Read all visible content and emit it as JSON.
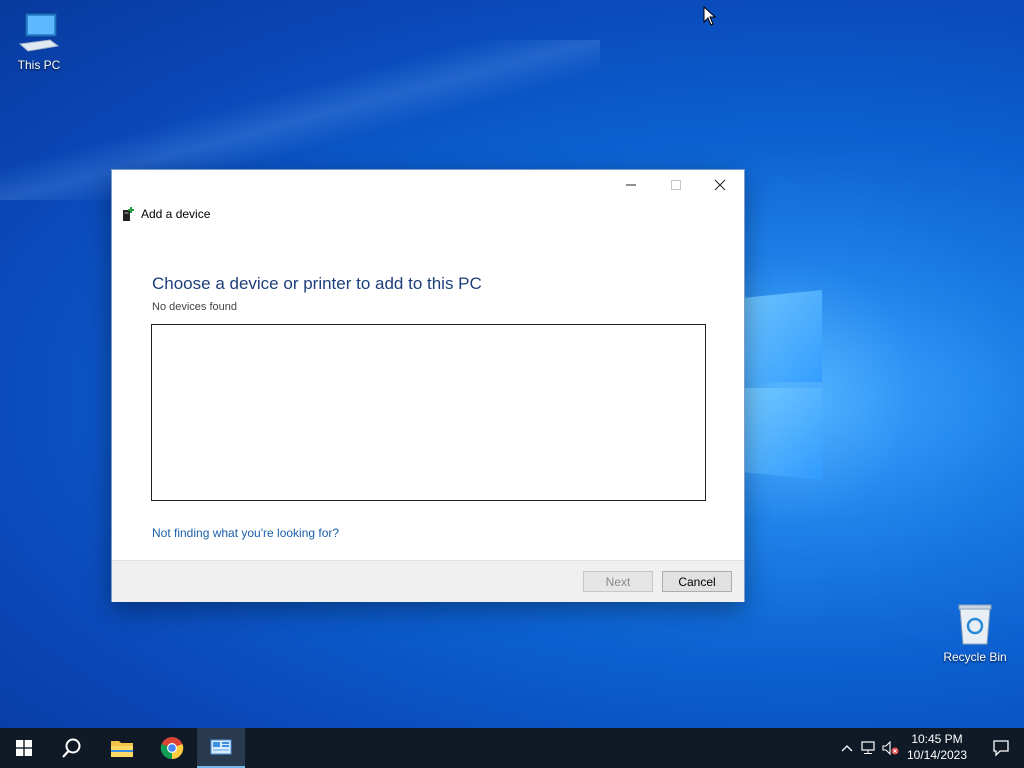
{
  "desktop": {
    "icons": [
      {
        "label": "This PC",
        "icon": "computer-icon"
      },
      {
        "label": "Recycle Bin",
        "icon": "recycle-bin-icon"
      }
    ]
  },
  "dialog": {
    "title": "Add a device",
    "heading": "Choose a device or printer to add to this PC",
    "status": "No devices found",
    "help_link": "Not finding what you're looking for?",
    "next_label": "Next",
    "cancel_label": "Cancel",
    "window_controls": [
      "minimize-icon",
      "maximize-icon",
      "close-icon"
    ]
  },
  "taskbar": {
    "items": [
      "start-icon",
      "search-icon",
      "file-explorer-icon",
      "chrome-icon",
      "devices-app-icon"
    ],
    "tray_icons": [
      "chevron-up-icon",
      "network-icon",
      "volume-muted-icon"
    ],
    "time": "10:45 PM",
    "date": "10/14/2023",
    "notification_icon": "action-center-icon"
  },
  "colors": {
    "heading": "#1e3f7a",
    "link": "#1a5fa8",
    "taskbar": "#0f1a26",
    "accent": "#76b9ed"
  }
}
